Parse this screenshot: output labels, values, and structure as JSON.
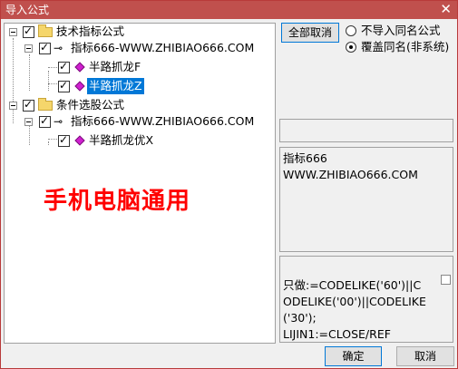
{
  "window": {
    "title": "导入公式",
    "close_glyph": "✕"
  },
  "tree": {
    "group1": {
      "label": "技术指标公式"
    },
    "item1": {
      "label": "指标666-WWW.ZHIBIAO666.COM"
    },
    "leaf1": {
      "label": "半路抓龙F"
    },
    "leaf2": {
      "label": "半路抓龙Z"
    },
    "group2": {
      "label": "条件选股公式"
    },
    "item2": {
      "label": "指标666-WWW.ZHIBIAO666.COM"
    },
    "leaf3": {
      "label": "半路抓龙优X"
    },
    "check_glyph": "✓",
    "key_glyph": "⊸"
  },
  "watermark": "手机电脑通用",
  "controls": {
    "cancel_all_label": "全部取消",
    "radio_no_import": "不导入同名公式",
    "radio_overwrite": "覆盖同名(非系统)"
  },
  "info": {
    "line1": "指标666",
    "line2": "WWW.ZHIBIAO666.COM"
  },
  "code": {
    "text": "只做:=CODELIKE('60')||CODELIKE('00')||CODELIKE('30');\nLIJIN1:=CLOSE/REF"
  },
  "footer": {
    "ok_label": "确定",
    "cancel_label": "取消"
  }
}
